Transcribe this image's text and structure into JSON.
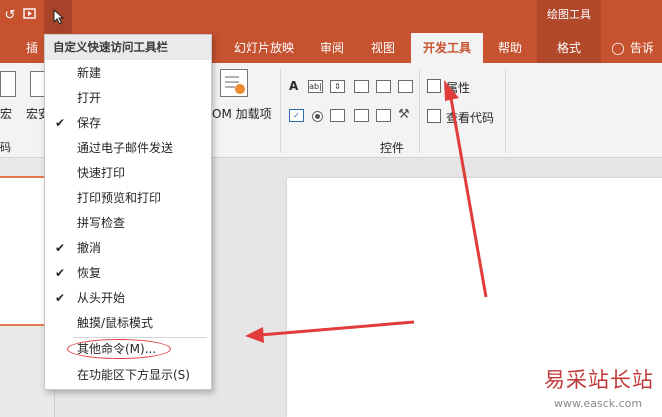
{
  "tabs": {
    "partial_left": "插",
    "slideshow": "幻灯片放映",
    "review": "审阅",
    "view": "视图",
    "developer": "开发工具",
    "help": "帮助",
    "format": "格式",
    "tell_me": "告诉",
    "contextual_header": "绘图工具"
  },
  "ribbon": {
    "macro_cut": "宏",
    "macro_label": "宏安",
    "code_group": "码",
    "addins_label": "OM 加载项",
    "controls_group": "控件",
    "properties_label": "属性",
    "view_code_label": "查看代码",
    "ctl_text": "A",
    "ctl_textbox": "ab|"
  },
  "menu": {
    "title": "自定义快速访问工具栏",
    "items": [
      {
        "label": "新建",
        "checked": false
      },
      {
        "label": "打开",
        "checked": false
      },
      {
        "label": "保存",
        "checked": true
      },
      {
        "label": "通过电子邮件发送",
        "checked": false
      },
      {
        "label": "快速打印",
        "checked": false
      },
      {
        "label": "打印预览和打印",
        "checked": false
      },
      {
        "label": "拼写检查",
        "checked": false
      },
      {
        "label": "撤消",
        "checked": true
      },
      {
        "label": "恢复",
        "checked": true
      },
      {
        "label": "从头开始",
        "checked": true
      },
      {
        "label": "触摸/鼠标模式",
        "checked": false
      },
      {
        "label": "其他命令(M)...",
        "checked": false
      },
      {
        "label": "在功能区下方显示(S)",
        "checked": false
      }
    ],
    "check_glyph": "✔"
  },
  "watermark": {
    "text": "易采站长站",
    "url": "www.easck.com"
  },
  "colors": {
    "brand": "#c6522f",
    "annotation": "#e03c3c"
  }
}
